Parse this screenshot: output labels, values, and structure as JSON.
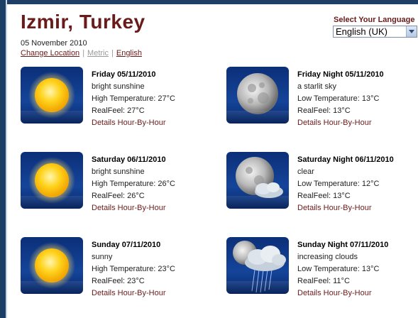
{
  "header": {
    "city": "Izmir, Turkey",
    "date": "05 November 2010",
    "change_location": "Change Location",
    "metric": "Metric",
    "english": "English",
    "separator": "|"
  },
  "language": {
    "label": "Select Your Language",
    "selected": "English (UK)"
  },
  "forecasts": [
    {
      "title": "Friday 05/11/2010",
      "condition": "bright sunshine",
      "temp": "High Temperature: 27°C",
      "realfeel": "RealFeel: 27°C",
      "details": "Details Hour-By-Hour",
      "icon": "sun-icon"
    },
    {
      "title": "Friday Night 05/11/2010",
      "condition": "a starlit sky",
      "temp": "Low Temperature: 13°C",
      "realfeel": "RealFeel: 13°C",
      "details": "Details Hour-By-Hour",
      "icon": "moon-icon"
    },
    {
      "title": "Saturday 06/11/2010",
      "condition": "bright sunshine",
      "temp": "High Temperature: 26°C",
      "realfeel": "RealFeel: 26°C",
      "details": "Details Hour-By-Hour",
      "icon": "sun-icon"
    },
    {
      "title": "Saturday Night 06/11/2010",
      "condition": "clear",
      "temp": "Low Temperature: 12°C",
      "realfeel": "RealFeel: 13°C",
      "details": "Details Hour-By-Hour",
      "icon": "moon-cloud-icon"
    },
    {
      "title": "Sunday 07/11/2010",
      "condition": "sunny",
      "temp": "High Temperature: 23°C",
      "realfeel": "RealFeel: 23°C",
      "details": "Details Hour-By-Hour",
      "icon": "sun-icon"
    },
    {
      "title": "Sunday Night 07/11/2010",
      "condition": "increasing clouds",
      "temp": "Low Temperature: 13°C",
      "realfeel": "RealFeel: 11°C",
      "details": "Details Hour-By-Hour",
      "icon": "moon-rain-cloud-icon"
    }
  ]
}
